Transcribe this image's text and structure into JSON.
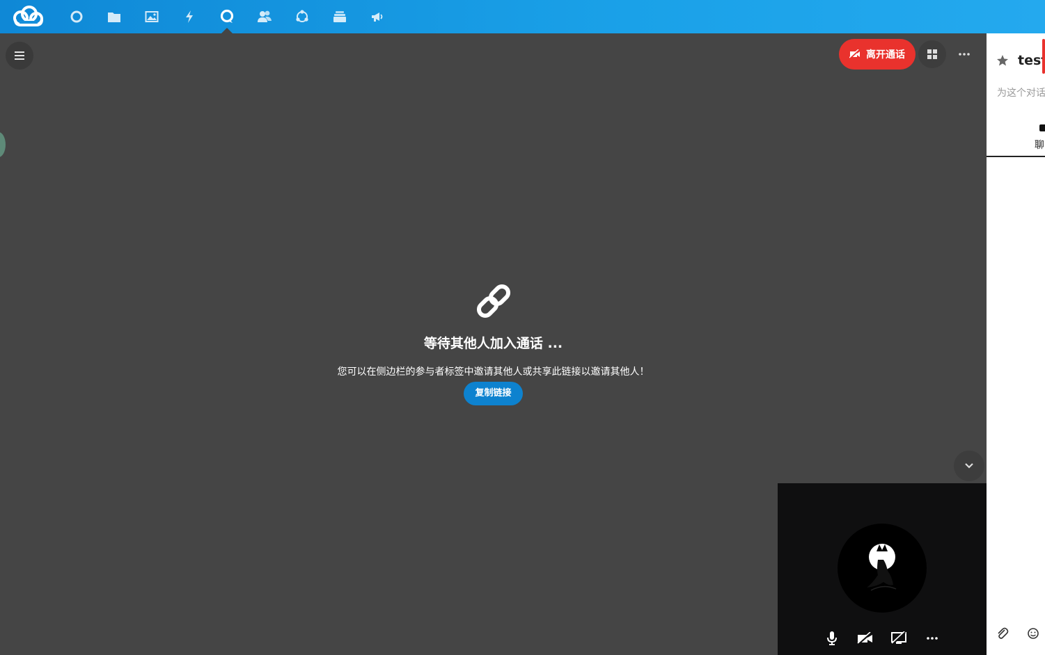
{
  "nav": {
    "items": [
      {
        "name": "dashboard"
      },
      {
        "name": "files"
      },
      {
        "name": "photos"
      },
      {
        "name": "activity"
      },
      {
        "name": "talk",
        "active": true
      },
      {
        "name": "contacts"
      },
      {
        "name": "circles"
      },
      {
        "name": "deck"
      },
      {
        "name": "announcements"
      }
    ]
  },
  "call": {
    "leave_label": "离开通话",
    "waiting_title": "等待其他人加入通话 ...",
    "waiting_hint": "您可以在侧边栏的参与者标签中邀请其他人或共享此链接以邀请其他人！",
    "copy_link_label": "复制链接"
  },
  "sidebar": {
    "title": "test",
    "description_placeholder": "为这个对话",
    "tab_label": "聊"
  },
  "colors": {
    "header": "#1aa1e8",
    "stage": "#454545",
    "leave": "#e9322d",
    "primary": "#0d82cf"
  }
}
